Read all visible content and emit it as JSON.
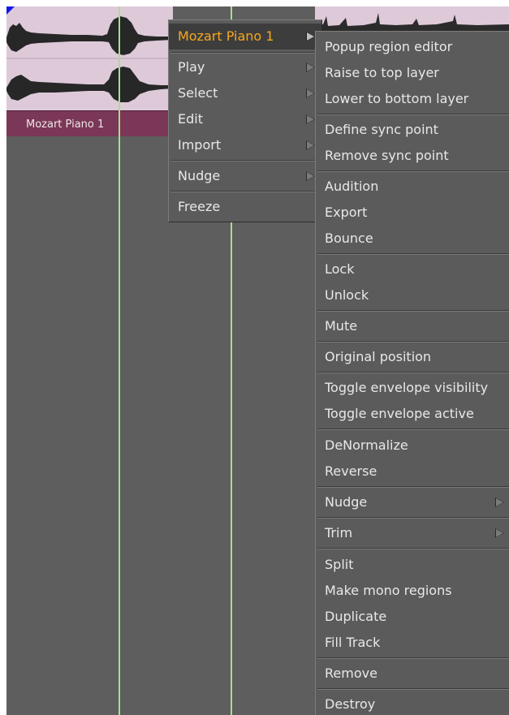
{
  "region": {
    "name": "Mozart Piano 1"
  },
  "main_menu": {
    "header": "Mozart Piano 1",
    "items": [
      "Play",
      "Select",
      "Edit",
      "Import",
      "Nudge",
      "Freeze"
    ]
  },
  "sub_menu": {
    "items": [
      "Popup region editor",
      "Raise to top layer",
      "Lower to bottom layer",
      "Define sync point",
      "Remove sync point",
      "Audition",
      "Export",
      "Bounce",
      "Lock",
      "Unlock",
      "Mute",
      "Original position",
      "Toggle envelope visibility",
      "Toggle envelope active",
      "DeNormalize",
      "Reverse",
      "Nudge",
      "Trim",
      "Split",
      "Make mono regions",
      "Duplicate",
      "Fill Track",
      "Remove",
      "Destroy"
    ]
  }
}
